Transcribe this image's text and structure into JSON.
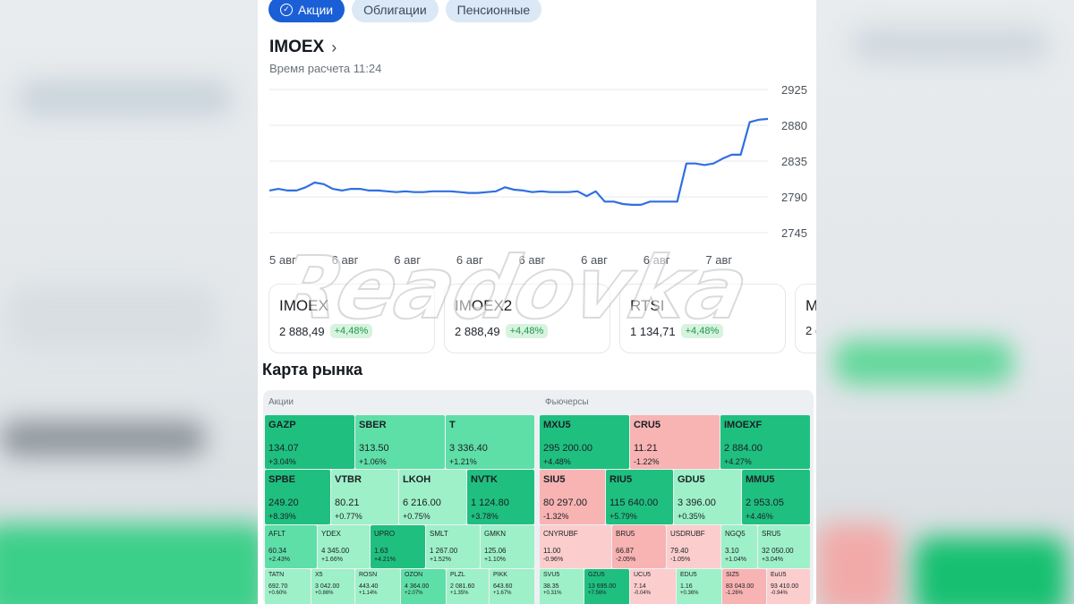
{
  "tabs": [
    {
      "label": "Акции",
      "active": true
    },
    {
      "label": "Облигации",
      "active": false
    },
    {
      "label": "Пенсионные",
      "active": false
    }
  ],
  "index": {
    "title": "IMOEX",
    "calc_time": "Время расчета 11:24"
  },
  "chart_data": {
    "type": "line",
    "series": [
      {
        "values": [
          2798,
          2800,
          2798,
          2798,
          2802,
          2808,
          2806,
          2800,
          2798,
          2800,
          2800,
          2798,
          2798,
          2797,
          2796,
          2797,
          2796,
          2796,
          2797,
          2797,
          2797,
          2796,
          2795,
          2795,
          2796,
          2797,
          2802,
          2799,
          2798,
          2796,
          2797,
          2796,
          2796,
          2796,
          2797,
          2791,
          2797,
          2784,
          2784,
          2781,
          2780,
          2780,
          2784,
          2784,
          2784,
          2784,
          2832,
          2832,
          2830,
          2832,
          2838,
          2843,
          2843,
          2884,
          2887,
          2888
        ]
      }
    ],
    "x_labels": [
      "5 авг",
      "6 авг",
      "6 авг",
      "6 авг",
      "6 авг",
      "6 авг",
      "6 авг",
      "7 авг"
    ],
    "y_ticks": [
      2925,
      2880,
      2835,
      2790,
      2745
    ],
    "ylim": [
      2745,
      2925
    ],
    "line_color": "#2f6fe0",
    "grid": true
  },
  "cards": [
    {
      "name": "IMOEX",
      "value": "2 888,49",
      "change": "+4,48%"
    },
    {
      "name": "IMOEX2",
      "value": "2 888,49",
      "change": "+4,48%"
    },
    {
      "name": "RTSI",
      "value": "1 134,71",
      "change": "+4,48%"
    },
    {
      "name": "M",
      "value": "2 (",
      "change": ""
    }
  ],
  "market_map": {
    "title": "Карта рынка",
    "stocks_label": "Акции",
    "futures_label": "Фьючерсы",
    "stocks": [
      {
        "t": "GAZP",
        "p": "134.07",
        "c": "+3.04%"
      },
      {
        "t": "SBER",
        "p": "313.50",
        "c": "+1.06%"
      },
      {
        "t": "T",
        "p": "3 336.40",
        "c": "+1.21%"
      },
      {
        "t": "SPBE",
        "p": "249.20",
        "c": "+8.39%"
      },
      {
        "t": "VTBR",
        "p": "80.21",
        "c": "+0.77%"
      },
      {
        "t": "LKOH",
        "p": "6 216.00",
        "c": "+0.75%"
      },
      {
        "t": "NVTK",
        "p": "1 124.80",
        "c": "+3.78%"
      },
      {
        "t": "AFLT",
        "p": "60.34",
        "c": "+2.43%"
      },
      {
        "t": "YDEX",
        "p": "4 345.00",
        "c": "+1.66%"
      },
      {
        "t": "UPRO",
        "p": "1.63",
        "c": "+4.21%"
      },
      {
        "t": "SMLT",
        "p": "1 267.00",
        "c": "+1.52%"
      },
      {
        "t": "GMKN",
        "p": "125.06",
        "c": "+1.10%"
      },
      {
        "t": "TATN",
        "p": "692.70",
        "c": "+0.60%"
      },
      {
        "t": "X5",
        "p": "3 042.00",
        "c": "+0.86%"
      },
      {
        "t": "ROSN",
        "p": "443.40",
        "c": "+1.14%"
      },
      {
        "t": "OZON",
        "p": "4 364.00",
        "c": "+2.07%"
      },
      {
        "t": "PLZL",
        "p": "2 081.60",
        "c": "+1.35%"
      },
      {
        "t": "PIKK",
        "p": "643.60",
        "c": "+1.67%"
      }
    ],
    "futures": [
      {
        "t": "MXU5",
        "p": "295 200.00",
        "c": "+4.48%"
      },
      {
        "t": "CRU5",
        "p": "11.21",
        "c": "-1.22%"
      },
      {
        "t": "IMOEXF",
        "p": "2 884.00",
        "c": "+4.27%"
      },
      {
        "t": "SIU5",
        "p": "80 297.00",
        "c": "-1.32%"
      },
      {
        "t": "RIU5",
        "p": "115 640.00",
        "c": "+5.79%"
      },
      {
        "t": "GDU5",
        "p": "3 396.00",
        "c": "+0.35%"
      },
      {
        "t": "MMU5",
        "p": "2 953.05",
        "c": "+4.46%"
      },
      {
        "t": "CNYRUBF",
        "p": "11.00",
        "c": "-0.96%"
      },
      {
        "t": "BRU5",
        "p": "66.87",
        "c": "-2.05%"
      },
      {
        "t": "USDRUBF",
        "p": "79.40",
        "c": "-1.05%"
      },
      {
        "t": "NGQ5",
        "p": "3.10",
        "c": "+1.04%"
      },
      {
        "t": "SRU5",
        "p": "32 050.00",
        "c": "+3.04%"
      },
      {
        "t": "SVU5",
        "p": "38.35",
        "c": "+0.31%"
      },
      {
        "t": "GZU5",
        "p": "13 695.00",
        "c": "+7.56%"
      },
      {
        "t": "UCU5",
        "p": "7.14",
        "c": "-0.04%"
      },
      {
        "t": "EDU5",
        "p": "1.16",
        "c": "+0.36%"
      },
      {
        "t": "SIZ5",
        "p": "83 043.00",
        "c": "-1.26%"
      },
      {
        "t": "EuU5",
        "p": "93 410.00",
        "c": "-0.94%"
      }
    ]
  },
  "watermark": "Readovka",
  "colors": {
    "accent": "#1b5fd6",
    "up": "#1d9a4b",
    "tile_green": "#2fcf8e",
    "tile_red": "#f8b3b3"
  }
}
